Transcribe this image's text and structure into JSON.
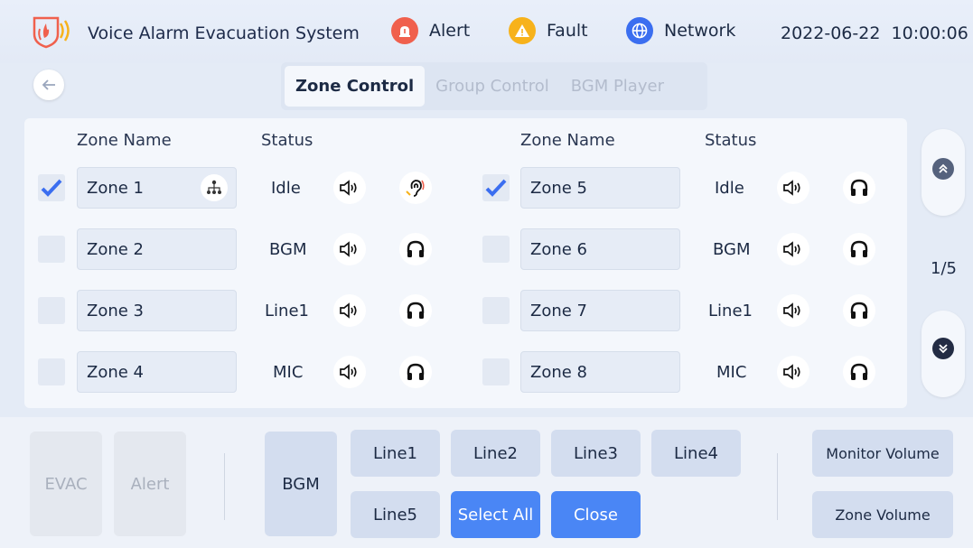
{
  "header": {
    "title": "Voice Alarm Evacuation System",
    "alert": "Alert",
    "fault": "Fault",
    "network": "Network",
    "date": "2022-06-22",
    "time": "10:00:06"
  },
  "tabs": [
    "Zone Control",
    "Group Control",
    "BGM Player"
  ],
  "table": {
    "col_zone": "Zone Name",
    "col_status": "Status",
    "left": [
      {
        "name": "Zone 1",
        "status": "Idle",
        "checked": true,
        "monitor": "ear"
      },
      {
        "name": "Zone 2",
        "status": "BGM",
        "checked": false,
        "monitor": "headphone"
      },
      {
        "name": "Zone 3",
        "status": "Line1",
        "checked": false,
        "monitor": "headphone"
      },
      {
        "name": "Zone 4",
        "status": "MIC",
        "checked": false,
        "monitor": "headphone"
      }
    ],
    "right": [
      {
        "name": "Zone 5",
        "status": "Idle",
        "checked": true,
        "monitor": "headphone"
      },
      {
        "name": "Zone 6",
        "status": "BGM",
        "checked": false,
        "monitor": "headphone"
      },
      {
        "name": "Zone 7",
        "status": "Line1",
        "checked": false,
        "monitor": "headphone"
      },
      {
        "name": "Zone 8",
        "status": "MIC",
        "checked": false,
        "monitor": "headphone"
      }
    ]
  },
  "pager": {
    "label": "1/5"
  },
  "bottom": {
    "evac": "EVAC",
    "alert": "Alert",
    "bgm": "BGM",
    "line1": "Line1",
    "line2": "Line2",
    "line3": "Line3",
    "line4": "Line4",
    "line5": "Line5",
    "select_all": "Select All",
    "close": "Close",
    "monitor_volume": "Monitor Volume",
    "zone_volume": "Zone Volume"
  },
  "colors": {
    "accent": "#4a86f5",
    "alert": "#f0604d",
    "fault": "#f7b21b",
    "network": "#3b6ef0",
    "checkmark": "#3b6ef0",
    "pager": "#55627d"
  }
}
